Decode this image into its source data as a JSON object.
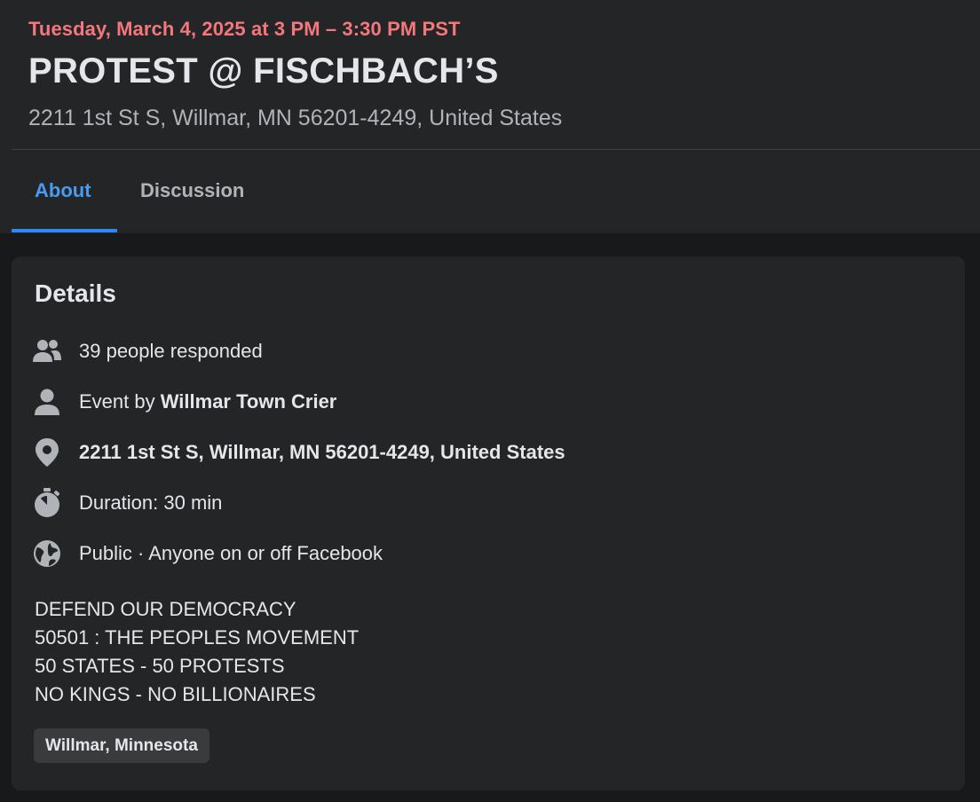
{
  "event": {
    "date": "Tuesday, March 4, 2025 at 3 PM – 3:30 PM PST",
    "title": "PROTEST @ FISCHBACH’S",
    "address": "2211 1st St S, Willmar, MN 56201-4249, United States"
  },
  "tabs": [
    {
      "label": "About",
      "active": true
    },
    {
      "label": "Discussion",
      "active": false
    }
  ],
  "details": {
    "title": "Details",
    "responded": "39 people responded",
    "event_by_prefix": "Event by ",
    "event_by_name": "Willmar Town Crier",
    "location": "2211 1st St S, Willmar, MN 56201-4249, United States",
    "duration": "Duration: 30 min",
    "privacy": "Public · Anyone on or off Facebook",
    "description": [
      "DEFEND OUR DEMOCRACY",
      "50501 : THE PEOPLES MOVEMENT",
      "50 STATES - 50 PROTESTS",
      "NO KINGS - NO BILLIONAIRES"
    ],
    "tag": "Willmar, Minnesota"
  },
  "icons": {
    "responded": "people-icon",
    "event_by": "person-icon",
    "location": "map-pin-icon",
    "duration": "stopwatch-icon",
    "privacy": "globe-icon"
  },
  "colors": {
    "background": "#18191a",
    "surface": "#242526",
    "date_accent": "#f3777d",
    "active_tab": "#4a9af1",
    "tab_underline": "#2d88ff",
    "secondary_text": "#b0b3b8",
    "icon": "#b0b3b8",
    "chip_bg": "#3a3b3c"
  }
}
